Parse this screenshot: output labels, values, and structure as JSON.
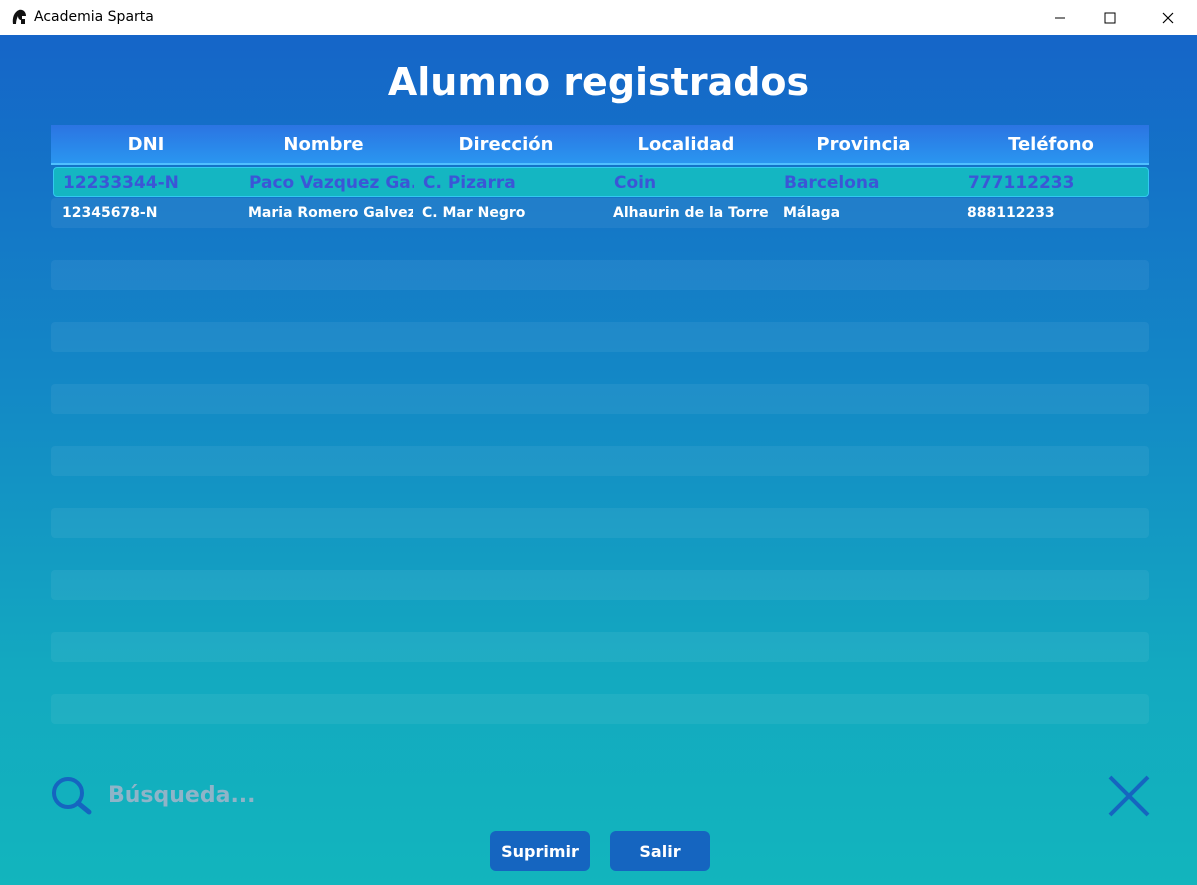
{
  "window": {
    "title": "Academia Sparta",
    "icon": "spartan-helmet-icon"
  },
  "page": {
    "title": "Alumno registrados"
  },
  "table": {
    "columns": [
      "DNI",
      "Nombre",
      "Dirección",
      "Localidad",
      "Provincia",
      "Teléfono"
    ],
    "rows": [
      [
        "12233344-N",
        "Paco Vazquez Ga...",
        "C. Pizarra",
        "Coin",
        "Barcelona",
        "777112233"
      ],
      [
        "12345678-N",
        "Maria Romero Galvez",
        "C. Mar Negro",
        "Alhaurin de la Torre",
        "Málaga",
        "888112233"
      ]
    ],
    "selected_row": 0
  },
  "search": {
    "placeholder": "Búsqueda...",
    "value": ""
  },
  "buttons": {
    "suprimir": "Suprimir",
    "salir": "Salir"
  },
  "colors": {
    "accent": "#1565c0",
    "selected_text": "#3b56d6",
    "selected_bg": "#14b6c2"
  }
}
